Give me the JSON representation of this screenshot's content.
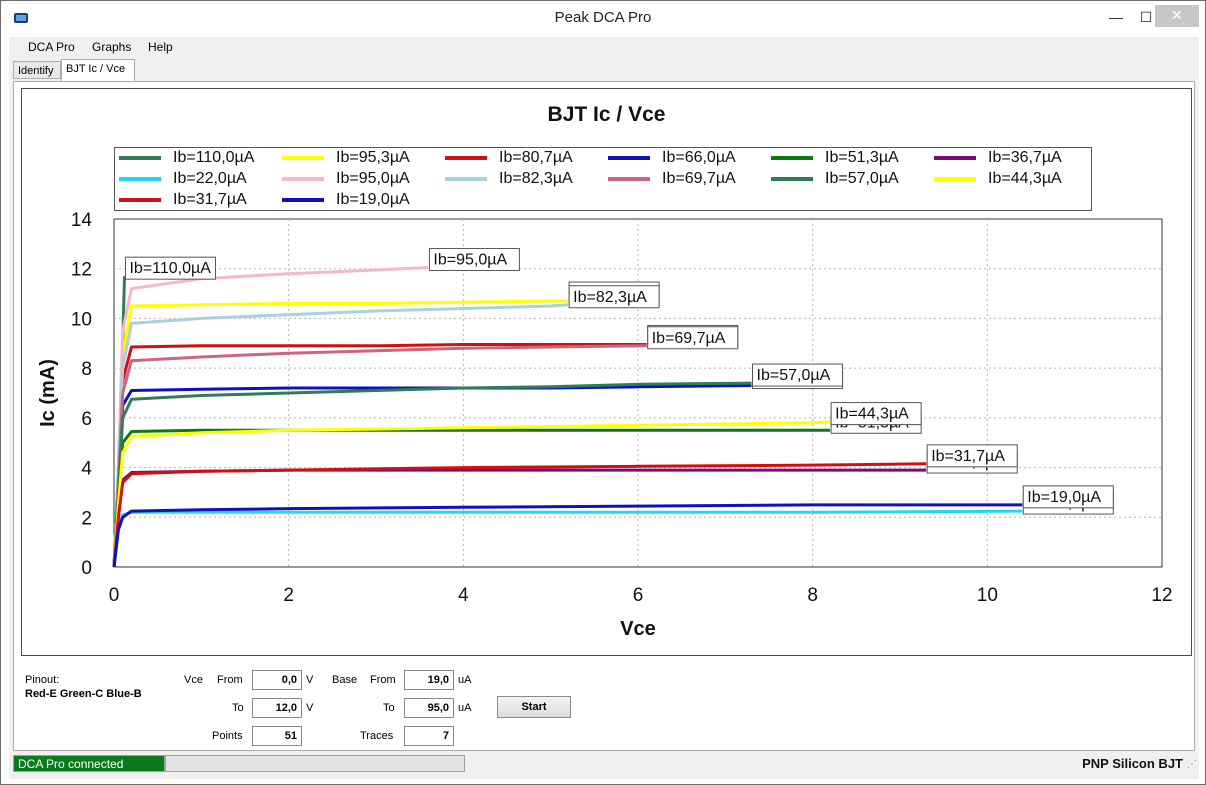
{
  "window": {
    "title": "Peak DCA Pro",
    "minimize_glyph": "—",
    "maximize_glyph": "☐",
    "close_glyph": "✕"
  },
  "menu": [
    "DCA Pro",
    "Graphs",
    "Help"
  ],
  "tabs": [
    {
      "label": "Identify",
      "active": false
    },
    {
      "label": "BJT Ic / Vce",
      "active": true
    }
  ],
  "chart_data": {
    "type": "line",
    "title": "BJT Ic / Vce",
    "xlabel": "Vce",
    "ylabel": "Ic (mA)",
    "xlim": [
      0,
      12
    ],
    "ylim": [
      0,
      14
    ],
    "xticks": [
      "0",
      "2",
      "4",
      "6",
      "8",
      "10",
      "12"
    ],
    "yticks": [
      "0",
      "2",
      "4",
      "6",
      "8",
      "10",
      "12",
      "14"
    ],
    "grid": true,
    "legend_placement": "top",
    "series": [
      {
        "name": "Ib=110,0µA",
        "color": "#2e7d57",
        "x": [
          0,
          0.05,
          0.1,
          0.12
        ],
        "y": [
          0,
          4.0,
          9.0,
          11.7
        ],
        "end_label": "Ib=110,0µA"
      },
      {
        "name": "Ib=95,3µA",
        "color": "#ffff00",
        "x": [
          0,
          0.05,
          0.1,
          0.2,
          1,
          2,
          3,
          4,
          5,
          5.2
        ],
        "y": [
          0,
          4.0,
          8.5,
          10.5,
          10.55,
          10.6,
          10.6,
          10.65,
          10.7,
          10.7
        ],
        "end_label": "Ib=95,3µA"
      },
      {
        "name": "Ib=80,7µA",
        "color": "#d01010",
        "x": [
          0,
          0.05,
          0.1,
          0.2,
          1,
          2,
          3,
          4,
          5,
          6.1
        ],
        "y": [
          0,
          3.5,
          7.5,
          8.85,
          8.9,
          8.9,
          8.9,
          8.95,
          8.95,
          8.95
        ],
        "end_label": "Ib=80,7µA"
      },
      {
        "name": "Ib=66,0µA",
        "color": "#1010c0",
        "x": [
          0,
          0.05,
          0.1,
          0.2,
          1,
          2,
          3,
          4,
          5,
          6,
          7.3
        ],
        "y": [
          0,
          3.0,
          6.5,
          7.1,
          7.15,
          7.2,
          7.2,
          7.2,
          7.2,
          7.25,
          7.3
        ],
        "end_label": "Ib=66,0µA"
      },
      {
        "name": "Ib=51,3µA",
        "color": "#0a7a0a",
        "x": [
          0,
          0.05,
          0.1,
          0.2,
          1,
          2,
          3,
          4,
          5,
          6,
          7,
          8.2
        ],
        "y": [
          0,
          2.5,
          5.0,
          5.45,
          5.5,
          5.5,
          5.5,
          5.5,
          5.5,
          5.5,
          5.5,
          5.5
        ],
        "end_label": "Ib=51,3µA"
      },
      {
        "name": "Ib=36,7µA",
        "color": "#7a0a7a",
        "x": [
          0,
          0.05,
          0.1,
          0.2,
          1,
          2,
          4,
          6,
          8,
          9.3
        ],
        "y": [
          0,
          2.0,
          3.5,
          3.8,
          3.85,
          3.9,
          3.9,
          3.9,
          3.9,
          3.9
        ],
        "end_label": "Ib=36,7µA"
      },
      {
        "name": "Ib=22,0µA",
        "color": "#22d8ee",
        "x": [
          0,
          0.05,
          0.1,
          0.2,
          1,
          2,
          4,
          6,
          8,
          10.4
        ],
        "y": [
          0,
          1.5,
          2.1,
          2.2,
          2.2,
          2.2,
          2.2,
          2.2,
          2.2,
          2.25
        ],
        "end_label": "Ib=22,0µA"
      },
      {
        "name": "Ib=95,0µA",
        "color": "#f5b8c4",
        "x": [
          0,
          0.05,
          0.1,
          0.2,
          1,
          2,
          3,
          3.6
        ],
        "y": [
          0,
          4.0,
          9.5,
          11.2,
          11.6,
          11.8,
          11.95,
          12.05
        ],
        "end_label": "Ib=95,0µA"
      },
      {
        "name": "Ib=82,3µA",
        "color": "#a9d2de",
        "x": [
          0,
          0.05,
          0.1,
          0.2,
          1,
          2,
          3,
          4,
          5,
          5.2
        ],
        "y": [
          0,
          4.0,
          8.0,
          9.8,
          10.0,
          10.15,
          10.3,
          10.4,
          10.5,
          10.55
        ],
        "end_label": "Ib=82,3µA"
      },
      {
        "name": "Ib=69,7µA",
        "color": "#cc6680",
        "x": [
          0,
          0.05,
          0.1,
          0.2,
          1,
          2,
          3,
          4,
          5,
          6.1
        ],
        "y": [
          0,
          3.5,
          7.0,
          8.3,
          8.45,
          8.6,
          8.7,
          8.8,
          8.85,
          8.9
        ],
        "end_label": "Ib=69,7µA"
      },
      {
        "name": "Ib=57,0µA",
        "color": "#2e7d57",
        "x": [
          0,
          0.05,
          0.1,
          0.2,
          1,
          2,
          3,
          4,
          5,
          6,
          7.3
        ],
        "y": [
          0,
          3.0,
          6.0,
          6.75,
          6.9,
          7.0,
          7.1,
          7.2,
          7.25,
          7.35,
          7.4
        ],
        "end_label": "Ib=57,0µA"
      },
      {
        "name": "Ib=44,3µA",
        "color": "#ffff00",
        "x": [
          0,
          0.05,
          0.1,
          0.2,
          1,
          2,
          4,
          6,
          8,
          8.2
        ],
        "y": [
          0,
          2.5,
          4.6,
          5.25,
          5.4,
          5.5,
          5.6,
          5.7,
          5.8,
          5.85
        ],
        "end_label": "Ib=44,3µA"
      },
      {
        "name": "Ib=31,7µA",
        "color": "#d01010",
        "x": [
          0,
          0.05,
          0.1,
          0.2,
          1,
          2,
          4,
          6,
          8,
          9.3
        ],
        "y": [
          0,
          2.0,
          3.4,
          3.75,
          3.85,
          3.9,
          4.0,
          4.05,
          4.1,
          4.15
        ],
        "end_label": "Ib=31,7µA"
      },
      {
        "name": "Ib=19,0µA",
        "color": "#1010c0",
        "x": [
          0,
          0.05,
          0.1,
          0.2,
          1,
          2,
          4,
          6,
          8,
          10.4
        ],
        "y": [
          0,
          1.5,
          2.0,
          2.25,
          2.3,
          2.35,
          2.4,
          2.45,
          2.5,
          2.5
        ],
        "end_label": "Ib=19,0µA"
      }
    ]
  },
  "controls": {
    "pinout_label": "Pinout:",
    "pinout_value": "Red-E Green-C Blue-B",
    "vce_label": "Vce",
    "from_label": "From",
    "to_label": "To",
    "vce_from": "0,0",
    "vce_to": "12,0",
    "vce_unit": "V",
    "base_label": "Base",
    "base_from": "19,0",
    "base_to": "95,0",
    "base_unit": "uA",
    "points_label": "Points",
    "points_value": "51",
    "traces_label": "Traces",
    "traces_value": "7",
    "start_label": "Start"
  },
  "status": {
    "connection": "DCA Pro connected",
    "connection_color": "#0a7a1c",
    "device": "PNP Silicon BJT"
  }
}
